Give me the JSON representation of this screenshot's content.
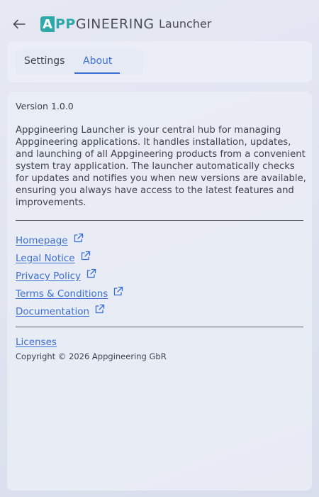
{
  "header": {
    "logo": {
      "mark": "A",
      "accent": "PP",
      "rest": "GINEERING"
    },
    "title": "Launcher"
  },
  "tabs": [
    {
      "label": "Settings",
      "active": false
    },
    {
      "label": "About",
      "active": true
    }
  ],
  "about": {
    "version": "Version 1.0.0",
    "description": "Appgineering Launcher is your central hub for managing Appgineering applications. It handles installation, updates, and launching of all Appgineering products from a convenient system tray application. The launcher automatically checks for updates and notifies you when new versions are available, ensuring you always have access to the latest features and improvements.",
    "links": [
      {
        "label": "Homepage",
        "icon": "external-link-icon"
      },
      {
        "label": "Legal Notice",
        "icon": "external-link-icon"
      },
      {
        "label": "Privacy Policy",
        "icon": "external-link-icon"
      },
      {
        "label": "Terms & Conditions",
        "icon": "external-link-icon"
      },
      {
        "label": "Documentation",
        "icon": "external-link-icon"
      }
    ],
    "licenses_label": "Licenses",
    "copyright": "Copyright © 2026 Appgineering GbR"
  },
  "colors": {
    "accent": "#3b6fd4",
    "brand": "#2ea8a8",
    "background": "#e2e6f1"
  },
  "icons": {
    "back": "arrow-left-icon"
  }
}
